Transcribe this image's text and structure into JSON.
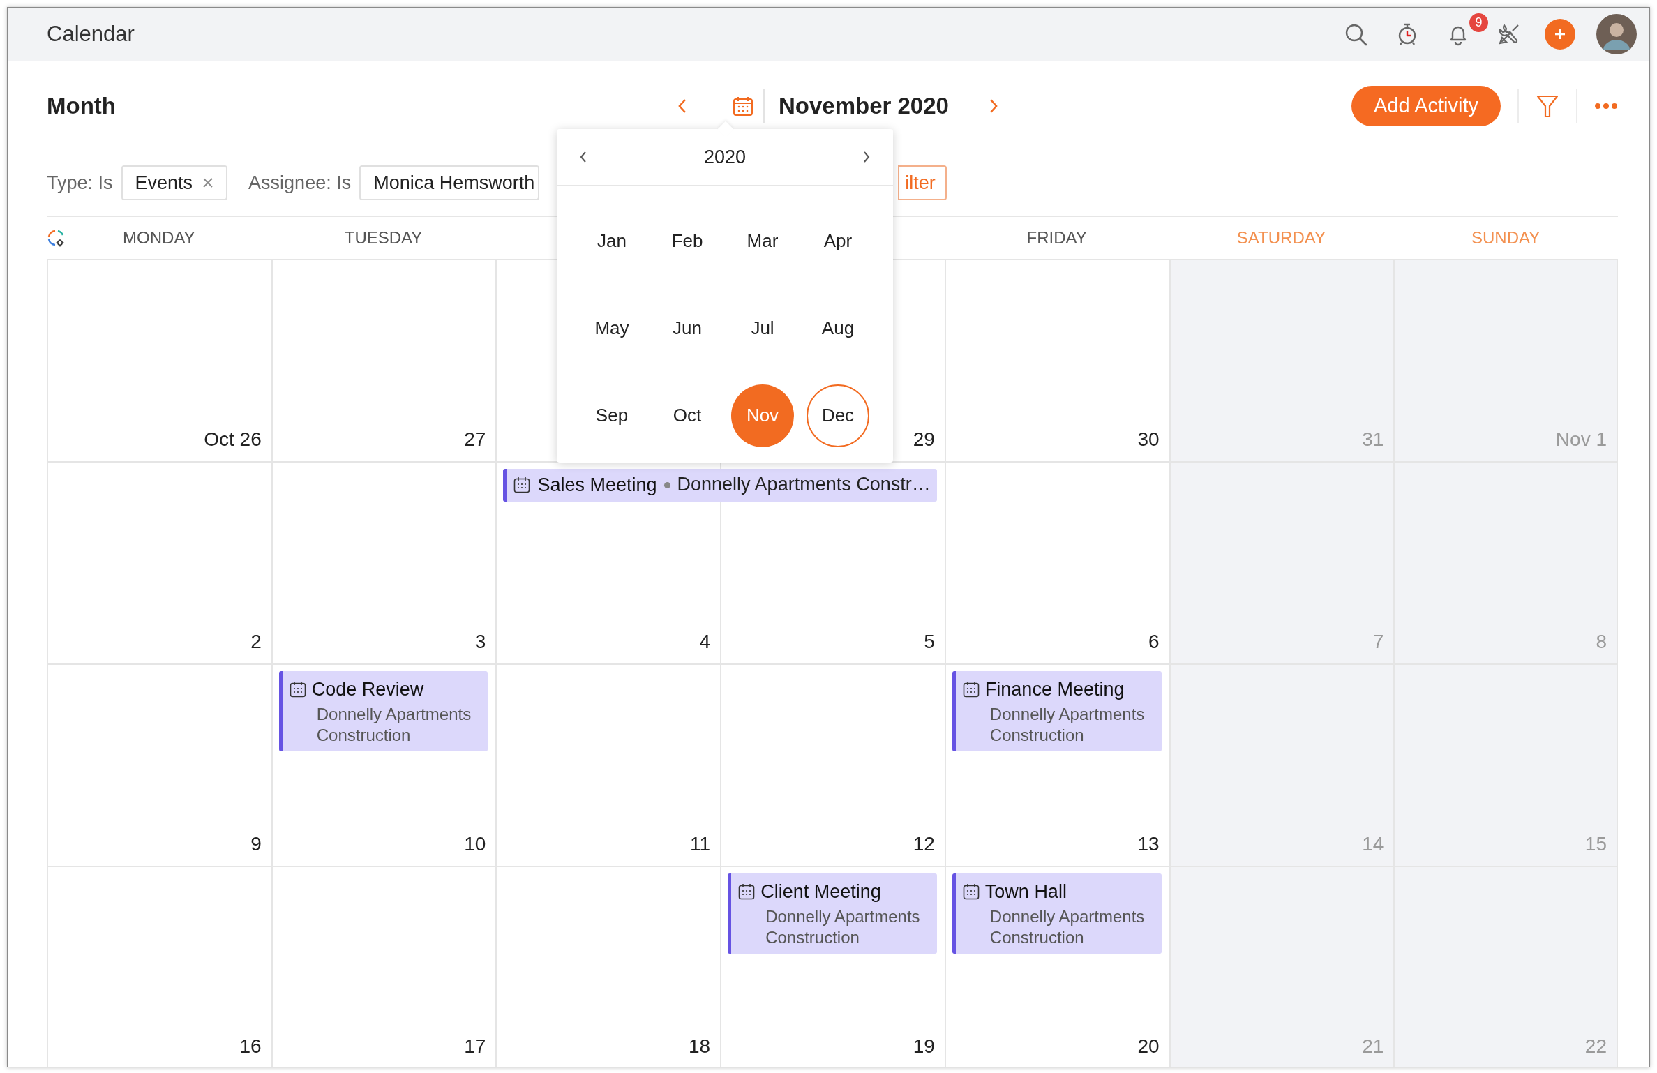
{
  "window": {
    "title": "Calendar"
  },
  "top_bar": {
    "notification_count": "9"
  },
  "toolbar": {
    "view": "Month",
    "period": "November 2020",
    "add_button": "Add Activity"
  },
  "filters": [
    {
      "label": "Type: Is",
      "value": "Events",
      "removable": true
    },
    {
      "label": "Assignee: Is",
      "value": "Monica Hemsworth",
      "removable": false
    }
  ],
  "filter_button": "ilter",
  "weekdays": [
    {
      "label": "MONDAY",
      "weekend": false
    },
    {
      "label": "TUESDAY",
      "weekend": false
    },
    {
      "label": "FRIDAY",
      "weekend": false
    },
    {
      "label": "SATURDAY",
      "weekend": true
    },
    {
      "label": "SUNDAY",
      "weekend": true
    }
  ],
  "weeks": [
    {
      "days": [
        {
          "date": "Oct 26",
          "weekend": false
        },
        {
          "date": "27",
          "weekend": false
        },
        {
          "weekend": false
        },
        {
          "date": "29",
          "weekend": false
        },
        {
          "date": "30",
          "weekend": false
        },
        {
          "date": "31",
          "weekend": true
        },
        {
          "date": "Nov 1",
          "weekend": true
        }
      ]
    },
    {
      "days": [
        {
          "date": "2",
          "weekend": false
        },
        {
          "date": "3",
          "weekend": false
        },
        {
          "date": "4",
          "weekend": false,
          "events": [
            {
              "kind": "bar",
              "title": "Sales Meeting",
              "subtitle": "Donnelly Apartments Constr…",
              "multi_day": true
            }
          ]
        },
        {
          "date": "5",
          "weekend": false
        },
        {
          "date": "6",
          "weekend": false
        },
        {
          "date": "7",
          "weekend": true
        },
        {
          "date": "8",
          "weekend": true
        }
      ]
    },
    {
      "days": [
        {
          "date": "9",
          "weekend": false
        },
        {
          "date": "10",
          "weekend": false,
          "events": [
            {
              "kind": "card",
              "title": "Code Review",
              "subtitle": "Donnelly Apartments Construction",
              "multi_day": false
            }
          ]
        },
        {
          "date": "11",
          "weekend": false
        },
        {
          "date": "12",
          "weekend": false
        },
        {
          "date": "13",
          "weekend": false,
          "events": [
            {
              "kind": "card",
              "title": "Finance Meeting",
              "subtitle": "Donnelly Apartments Construction",
              "multi_day": false
            }
          ]
        },
        {
          "date": "14",
          "weekend": true
        },
        {
          "date": "15",
          "weekend": true
        }
      ]
    },
    {
      "days": [
        {
          "date": "16",
          "weekend": false
        },
        {
          "date": "17",
          "weekend": false
        },
        {
          "date": "18",
          "weekend": false
        },
        {
          "date": "19",
          "weekend": false,
          "events": [
            {
              "kind": "card",
              "title": "Client Meeting",
              "subtitle": "Donnelly Apartments Construction",
              "multi_day": false
            }
          ]
        },
        {
          "date": "20",
          "weekend": false,
          "events": [
            {
              "kind": "card",
              "title": "Town Hall",
              "subtitle": "Donnelly Apartments Construction",
              "multi_day": false
            }
          ]
        },
        {
          "date": "21",
          "weekend": true
        },
        {
          "date": "22",
          "weekend": true
        }
      ]
    }
  ],
  "month_picker": {
    "year": "2020",
    "months": [
      {
        "label": "Jan",
        "selected": false,
        "current": false
      },
      {
        "label": "Feb",
        "selected": false,
        "current": false
      },
      {
        "label": "Mar",
        "selected": false,
        "current": false
      },
      {
        "label": "Apr",
        "selected": false,
        "current": false
      },
      {
        "label": "May",
        "selected": false,
        "current": false
      },
      {
        "label": "Jun",
        "selected": false,
        "current": false
      },
      {
        "label": "Jul",
        "selected": false,
        "current": false
      },
      {
        "label": "Aug",
        "selected": false,
        "current": false
      },
      {
        "label": "Sep",
        "selected": false,
        "current": false
      },
      {
        "label": "Oct",
        "selected": false,
        "current": false
      },
      {
        "label": "Nov",
        "selected": true,
        "current": false
      },
      {
        "label": "Dec",
        "selected": false,
        "current": true
      }
    ]
  }
}
